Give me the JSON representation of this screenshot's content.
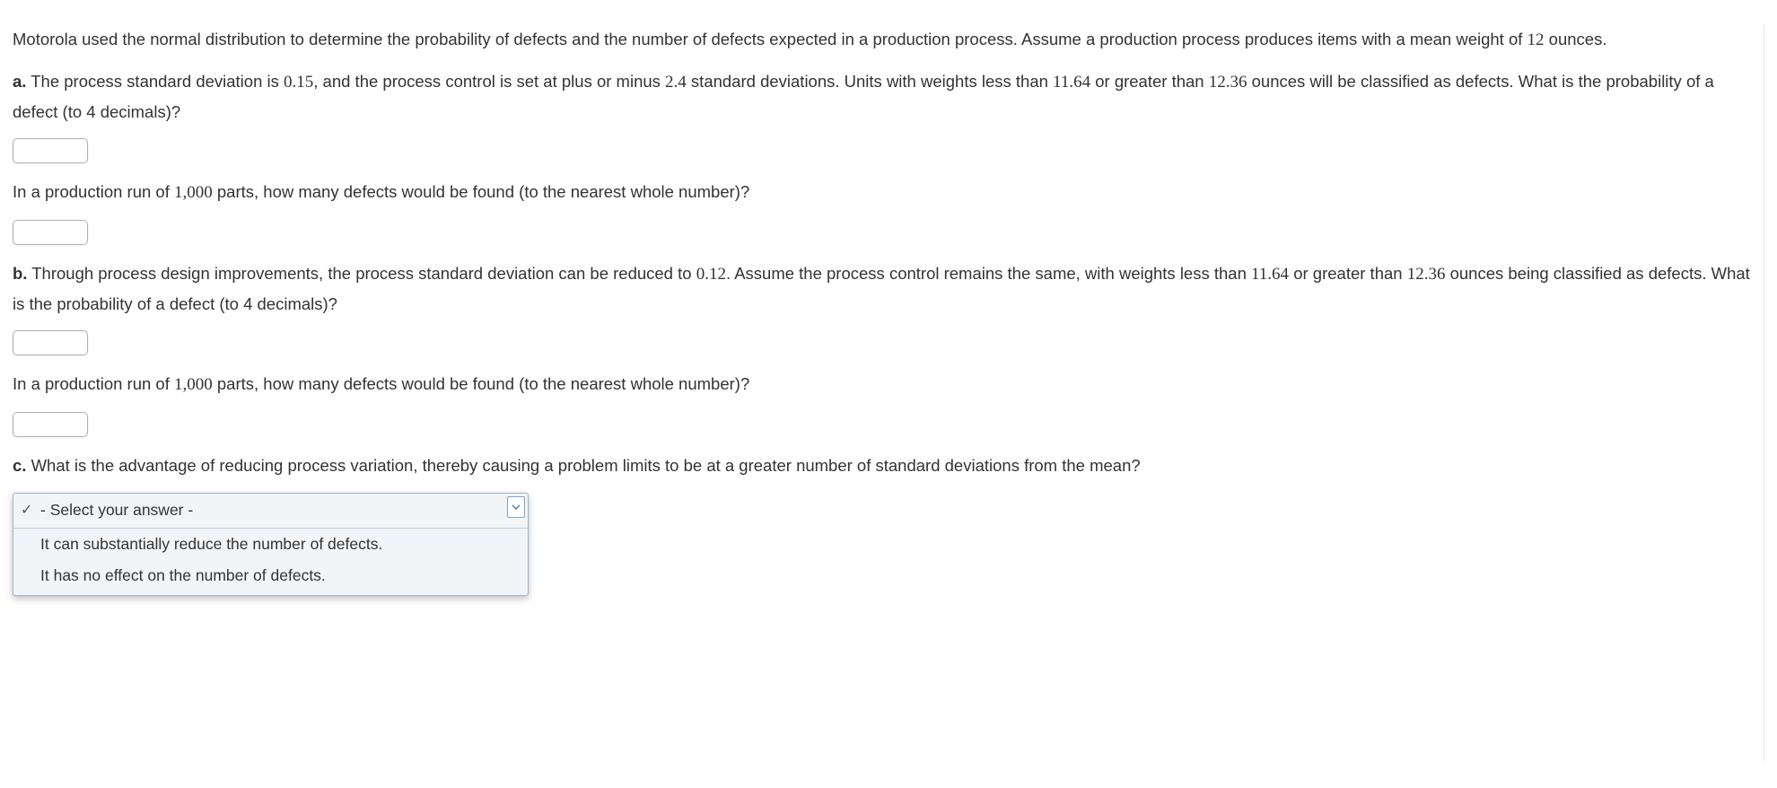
{
  "intro": {
    "p1_a": "Motorola used the normal distribution to determine the probability of defects and the number of defects expected in a production process. Assume a production process produces items with a mean weight of ",
    "mean": "12",
    "p1_b": " ounces."
  },
  "part_a": {
    "label": "a.",
    "t1": " The process standard deviation is ",
    "sd": "0.15",
    "t2": ", and the process control is set at plus or minus ",
    "sdlimit": "2.4",
    "t3": " standard deviations. Units with weights less than ",
    "low": "11.64",
    "t4": " or greater than ",
    "high": "12.36",
    "t5": " ounces will be classified as defects. What is the probability of a defect (to 4 decimals)?",
    "q2_a": "In a production run of ",
    "runsize": "1,000",
    "q2_b": " parts, how many defects would be found (to the nearest whole number)?"
  },
  "part_b": {
    "label": "b.",
    "t1": " Through process design improvements, the process standard deviation can be reduced to ",
    "sd": "0.12",
    "t2": ". Assume the process control remains the same, with weights less than ",
    "low": "11.64",
    "t3": " or greater than ",
    "high": "12.36",
    "t4": " ounces being classified as defects. What is the probability of a defect (to 4 decimals)?",
    "q2_a": "In a production run of ",
    "runsize": "1,000",
    "q2_b": " parts, how many defects would be found (to the nearest whole number)?"
  },
  "part_c": {
    "label": "c.",
    "t1": " What is the advantage of reducing process variation, thereby causing a problem limits to be at a greater number of standard deviations from the mean?"
  },
  "dropdown": {
    "selected": "- Select your answer -",
    "opt1": "It can substantially reduce the number of defects.",
    "opt2": "It has no effect on the number of defects."
  }
}
